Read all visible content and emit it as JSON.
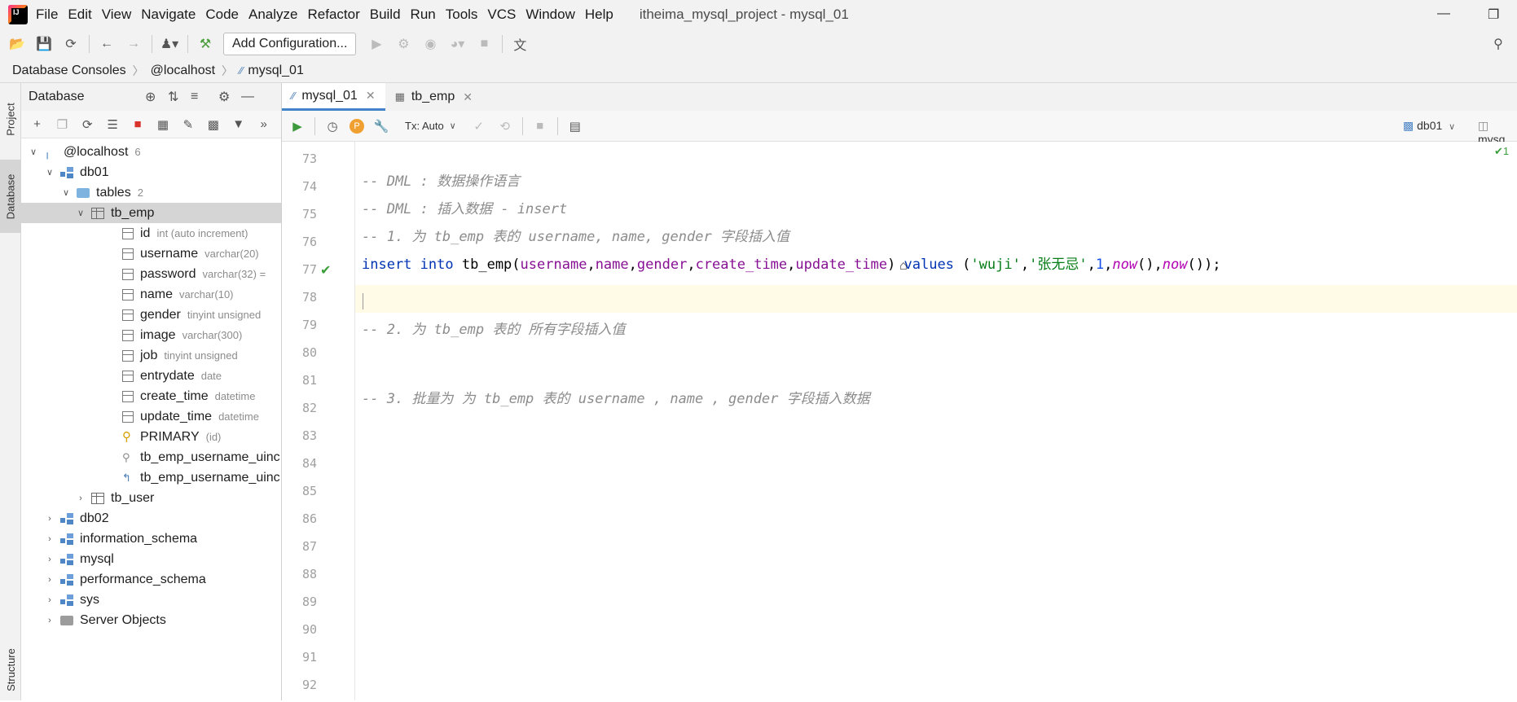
{
  "menubar": {
    "items": [
      "File",
      "Edit",
      "View",
      "Navigate",
      "Code",
      "Analyze",
      "Refactor",
      "Build",
      "Run",
      "Tools",
      "VCS",
      "Window",
      "Help"
    ],
    "window_title": "itheima_mysql_project - mysql_01"
  },
  "toolbar": {
    "add_configuration": "Add Configuration..."
  },
  "breadcrumb": [
    "Database Consoles",
    "@localhost",
    "mysql_01"
  ],
  "left_strip": {
    "project": "Project",
    "database": "Database",
    "structure": "Structure"
  },
  "db_panel": {
    "title": "Database",
    "tree": {
      "host": {
        "label": "@localhost",
        "count": "6"
      },
      "db01": "db01",
      "tables": {
        "label": "tables",
        "count": "2"
      },
      "tb_emp": "tb_emp",
      "columns": [
        {
          "name": "id",
          "type": "int (auto increment)"
        },
        {
          "name": "username",
          "type": "varchar(20)"
        },
        {
          "name": "password",
          "type": "varchar(32) ="
        },
        {
          "name": "name",
          "type": "varchar(10)"
        },
        {
          "name": "gender",
          "type": "tinyint unsigned"
        },
        {
          "name": "image",
          "type": "varchar(300)"
        },
        {
          "name": "job",
          "type": "tinyint unsigned"
        },
        {
          "name": "entrydate",
          "type": "date"
        },
        {
          "name": "create_time",
          "type": "datetime"
        },
        {
          "name": "update_time",
          "type": "datetime"
        }
      ],
      "primary": {
        "name": "PRIMARY",
        "type": "(id)"
      },
      "index1": "tb_emp_username_uinc",
      "index2": "tb_emp_username_uinc",
      "tb_user": "tb_user",
      "schemas": [
        "db02",
        "information_schema",
        "mysql",
        "performance_schema",
        "sys"
      ],
      "server_objects": "Server Objects"
    }
  },
  "editor": {
    "tabs": [
      {
        "label": "mysql_01"
      },
      {
        "label": "tb_emp"
      }
    ],
    "tx_mode": "Tx: Auto",
    "schema_selector": "db01",
    "console_selector": "mysq",
    "inspection_count": "1",
    "line_numbers": [
      "73",
      "74",
      "75",
      "76",
      "77",
      "78",
      "79",
      "80",
      "81",
      "82",
      "83",
      "84",
      "85",
      "86",
      "87",
      "88",
      "89",
      "90",
      "91",
      "92"
    ],
    "lines": {
      "l74": "-- DML : 数据操作语言",
      "l75": "-- DML : 插入数据 - insert",
      "l76": "-- 1. 为 tb_emp 表的 username, name, gender 字段插入值",
      "l80": "-- 2. 为 tb_emp 表的 所有字段插入值",
      "l83": "-- 3. 批量为 为 tb_emp 表的 username , name , gender 字段插入数据"
    },
    "insert": {
      "kw_insert": "insert",
      "kw_into": "into",
      "table": "tb_emp",
      "c1": "username",
      "c2": "name",
      "c3": "gender",
      "c4": "create_time",
      "c5": "update_time",
      "kw_values": "values",
      "s1": "'wuji'",
      "s2": "'张无忌'",
      "n1": "1",
      "f1": "now",
      "f2": "now"
    }
  }
}
